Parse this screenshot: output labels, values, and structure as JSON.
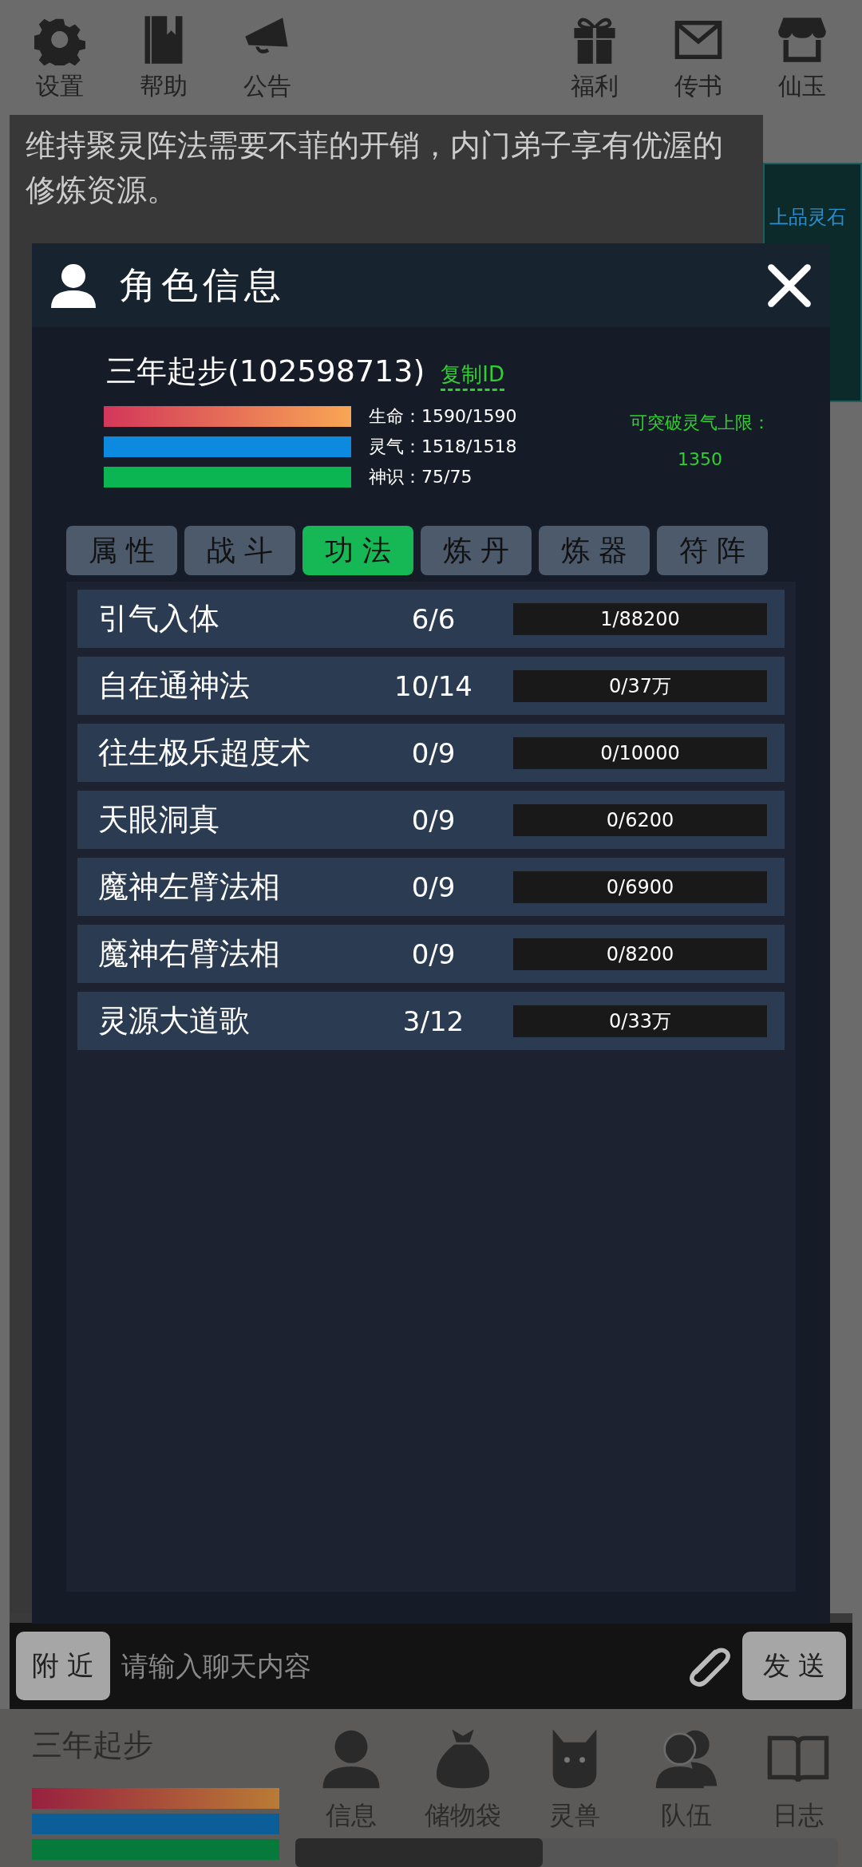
{
  "top_bar": {
    "left": [
      {
        "label": "设置"
      },
      {
        "label": "帮助"
      },
      {
        "label": "公告"
      }
    ],
    "right": [
      {
        "label": "福利"
      },
      {
        "label": "传书"
      },
      {
        "label": "仙玉"
      }
    ]
  },
  "notice": "维持聚灵阵法需要不菲的开销，内门弟子享有优渥的修炼资源。",
  "side_panel": {
    "label": "上品灵石"
  },
  "dialog": {
    "title": "角色信息",
    "player": {
      "name": "三年起步(102598713)",
      "copy_link": "复制ID"
    },
    "stats": [
      {
        "label": "生命：1590/1590"
      },
      {
        "label": "灵气：1518/1518"
      },
      {
        "label": "神识：75/75"
      }
    ],
    "breakthrough": {
      "label": "可突破灵气上限：",
      "value": "1350"
    },
    "tabs": [
      {
        "label": "属 性",
        "selected": false
      },
      {
        "label": "战 斗",
        "selected": false
      },
      {
        "label": "功 法",
        "selected": true
      },
      {
        "label": "炼 丹",
        "selected": false
      },
      {
        "label": "炼 器",
        "selected": false
      },
      {
        "label": "符 阵",
        "selected": false
      }
    ],
    "skills": [
      {
        "name": "引气入体",
        "rank": "6/6",
        "exp": "1/88200"
      },
      {
        "name": "自在通神法",
        "rank": "10/14",
        "exp": "0/37万"
      },
      {
        "name": "往生极乐超度术",
        "rank": "0/9",
        "exp": "0/10000"
      },
      {
        "name": "天眼洞真",
        "rank": "0/9",
        "exp": "0/6200"
      },
      {
        "name": "魔神左臂法相",
        "rank": "0/9",
        "exp": "0/6900"
      },
      {
        "name": "魔神右臂法相",
        "rank": "0/9",
        "exp": "0/8200"
      },
      {
        "name": "灵源大道歌",
        "rank": "3/12",
        "exp": "0/33万"
      }
    ]
  },
  "chat": {
    "channel": "附 近",
    "placeholder": "请输入聊天内容",
    "send": "发 送"
  },
  "footer": {
    "name": "三年起步",
    "nav": [
      {
        "label": "信息"
      },
      {
        "label": "储物袋"
      },
      {
        "label": "灵兽"
      },
      {
        "label": "队伍"
      },
      {
        "label": "日志"
      }
    ]
  }
}
